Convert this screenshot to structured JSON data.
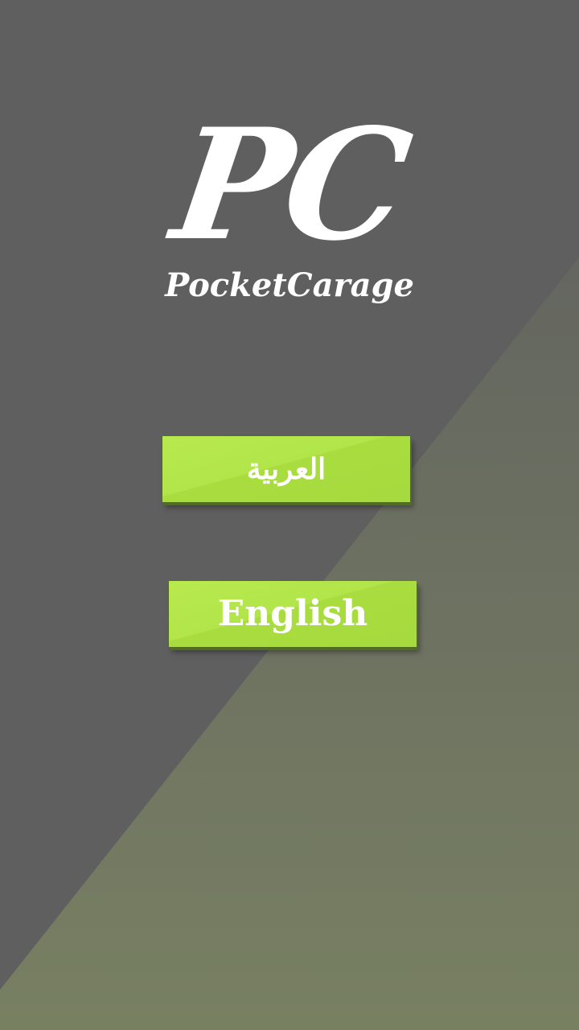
{
  "app": {
    "logo_mark": "PC",
    "logo_name": "PocketCarage"
  },
  "language_buttons": {
    "arabic_label": "العربية",
    "english_label": "English"
  },
  "colors": {
    "background_dark": "#5f5f5f",
    "background_olive": "#787f62",
    "button_green": "#b2e54a",
    "button_text": "#ffffff"
  }
}
